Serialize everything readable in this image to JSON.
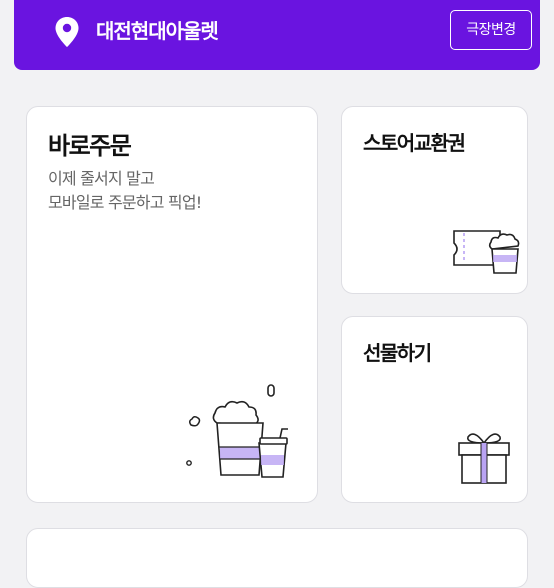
{
  "header": {
    "theater_name": "대전현대아울렛",
    "change_button": "극장변경",
    "location_icon": "location-pin-icon",
    "background_color": "#6a14e0"
  },
  "cards": {
    "direct_order": {
      "title": "바로주문",
      "subtitle_line1": "이제 줄서지 말고",
      "subtitle_line2": "모바일로 주문하고 픽업!",
      "icon": "popcorn-drink-icon"
    },
    "store_voucher": {
      "title": "스토어교환권",
      "icon": "ticket-popcorn-icon"
    },
    "gift": {
      "title": "선물하기",
      "icon": "gift-box-icon"
    }
  },
  "colors": {
    "accent": "#6a14e0",
    "icon_purple": "#b9a3f3"
  }
}
